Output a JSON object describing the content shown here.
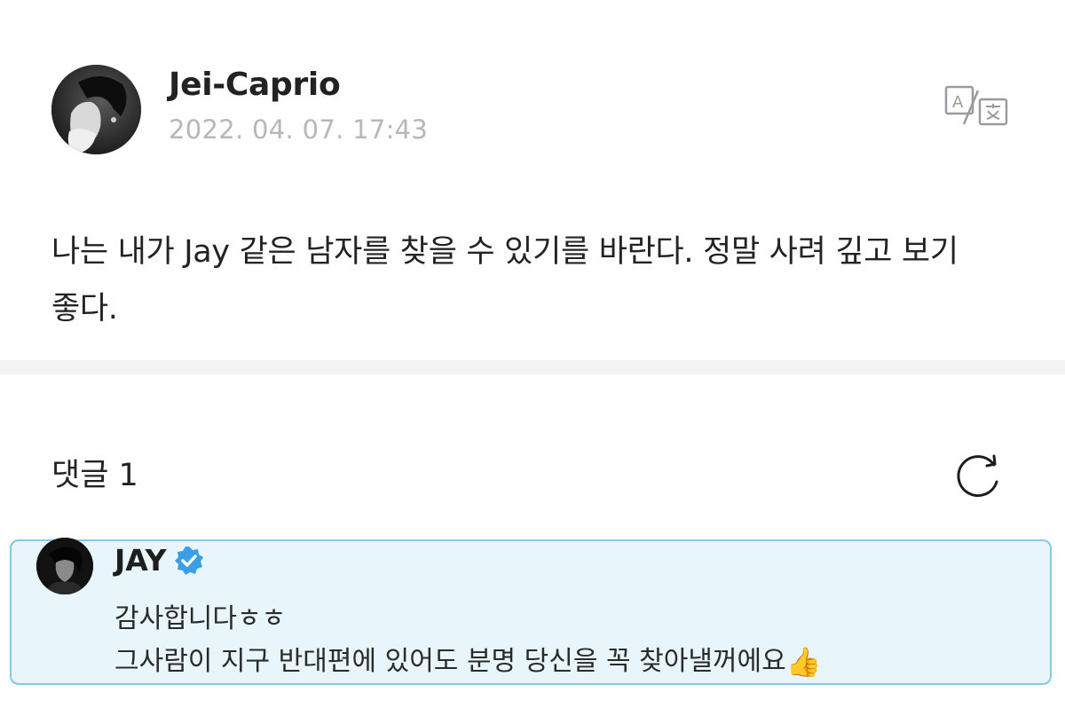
{
  "post": {
    "author": "Jei-Caprio",
    "timestamp": "2022. 04. 07. 17:43",
    "body": "나는 내가 Jay 같은 남자를 찾을 수 있기를 바란다. 정말 사려 깊고 보기 좋다.",
    "translate_icon": "translate-icon"
  },
  "comments": {
    "label": "댓글 1",
    "refresh_icon": "refresh-icon",
    "items": [
      {
        "author": "JAY",
        "verified": true,
        "line1": "감사합니다ㅎㅎ",
        "line2": "그사람이 지구 반대편에 있어도 분명 당신을 꼭 찾아낼꺼에요",
        "emoji": "👍"
      }
    ]
  },
  "colors": {
    "highlight_bg": "#e8f6fc",
    "highlight_border": "#86c9e6",
    "verified_blue": "#3b9fe6",
    "timestamp_gray": "#b6b6bb"
  }
}
